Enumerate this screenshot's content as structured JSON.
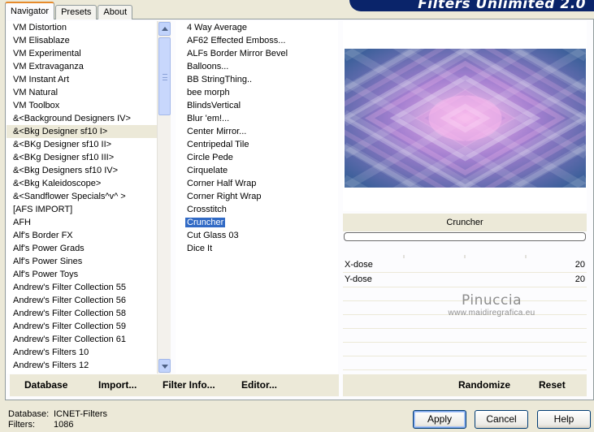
{
  "banner": {
    "title": "Filters Unlimited 2.0"
  },
  "tabs": [
    {
      "label": "Navigator",
      "active": true
    },
    {
      "label": "Presets",
      "active": false
    },
    {
      "label": "About",
      "active": false
    }
  ],
  "categories": {
    "items": [
      "VM Distortion",
      "VM Elisablaze",
      "VM Experimental",
      "VM Extravaganza",
      "VM Instant Art",
      "VM Natural",
      "VM Toolbox",
      "&<Background Designers IV>",
      "&<Bkg Designer sf10 I>",
      "&<BKg Designer sf10 II>",
      "&<BKg Designer sf10 III>",
      "&<Bkg Designers sf10 IV>",
      "&<Bkg Kaleidoscope>",
      "&<Sandflower Specials^v^ >",
      "[AFS IMPORT]",
      "AFH",
      "Alf's Border FX",
      "Alf's Power Grads",
      "Alf's Power Sines",
      "Alf's Power Toys",
      "Andrew's Filter Collection 55",
      "Andrew's Filter Collection 56",
      "Andrew's Filter Collection 58",
      "Andrew's Filter Collection 59",
      "Andrew's Filter Collection 61",
      "Andrew's Filters 10",
      "Andrew's Filters 12"
    ],
    "selected_index": 8
  },
  "filters": {
    "items": [
      "4 Way Average",
      "AF62 Effected Emboss...",
      "ALFs Border Mirror Bevel",
      "Balloons...",
      "BB StringThing..",
      "bee morph",
      "BlindsVertical",
      "Blur 'em!...",
      "Center Mirror...",
      "Centripedal Tile",
      "Circle Pede",
      "Cirquelate",
      "Corner Half Wrap",
      "Corner Right Wrap",
      "Crosstitch",
      "Cruncher",
      "Cut Glass  03",
      "Dice It"
    ],
    "selected_index": 15
  },
  "preview": {
    "colors": {
      "edge": "#3a5f99",
      "mid": "#a37fd0",
      "glow": "#f7b8ec"
    }
  },
  "filter_name": "Cruncher",
  "progress": 0,
  "params": [
    {
      "label": "X-dose",
      "value": "20"
    },
    {
      "label": "Y-dose",
      "value": "20"
    }
  ],
  "watermark": {
    "line1": "Pinuccia",
    "line2": "www.maidiregrafica.eu"
  },
  "left_buttons": {
    "database": "Database",
    "import": "Import...",
    "filter_info": "Filter Info...",
    "editor": "Editor..."
  },
  "right_buttons": {
    "randomize": "Randomize",
    "reset": "Reset"
  },
  "status": {
    "database_label": "Database:",
    "database_value": "ICNET-Filters",
    "filters_label": "Filters:",
    "filters_value": "1086"
  },
  "dialog_buttons": {
    "apply": "Apply",
    "cancel": "Cancel",
    "help": "Help"
  }
}
